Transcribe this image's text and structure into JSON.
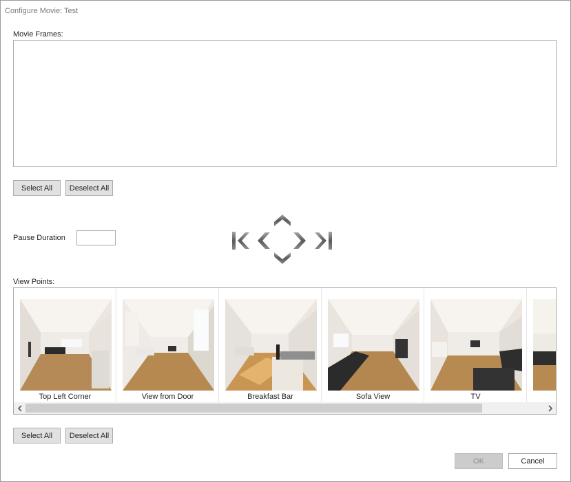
{
  "window": {
    "title": "Configure Movie: Test"
  },
  "movie_frames": {
    "label": "Movie Frames:",
    "select_all": "Select All",
    "deselect_all": "Deselect All"
  },
  "pause": {
    "label": "Pause Duration",
    "value": ""
  },
  "navigation": {
    "icons": [
      "skip-to-first-icon",
      "previous-icon",
      "move-up-icon",
      "move-down-icon",
      "next-icon",
      "skip-to-last-icon"
    ]
  },
  "view_points": {
    "label": "View Points:",
    "items": [
      {
        "caption": "Top Left Corner"
      },
      {
        "caption": "View from Door"
      },
      {
        "caption": "Breakfast Bar"
      },
      {
        "caption": "Sofa View"
      },
      {
        "caption": "TV"
      },
      {
        "caption": ""
      }
    ],
    "scroll_left_icon": "chevron-left-icon",
    "scroll_right_icon": "chevron-right-icon",
    "select_all": "Select All",
    "deselect_all": "Deselect All"
  },
  "dialog_buttons": {
    "ok": "OK",
    "cancel": "Cancel"
  }
}
